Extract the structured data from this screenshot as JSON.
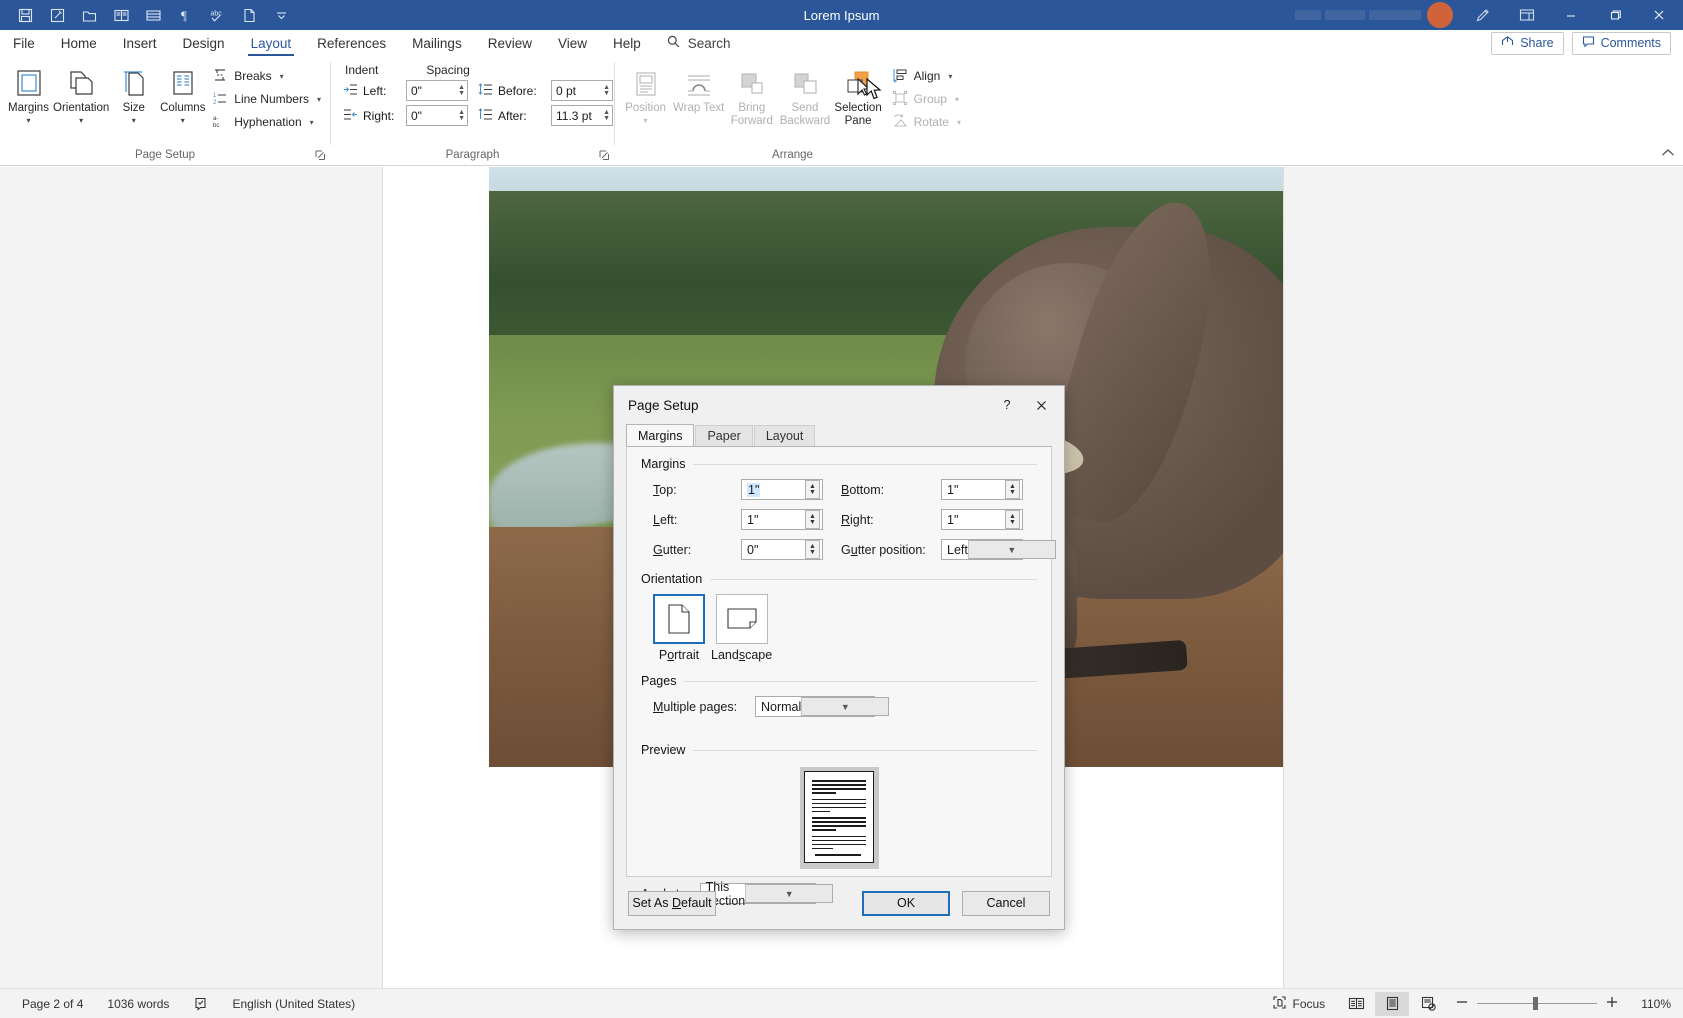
{
  "titlebar": {
    "document_title": "Lorem Ipsum",
    "quick_access": [
      {
        "name": "save-icon",
        "label": "Save"
      },
      {
        "name": "track-changes-icon",
        "label": "Track Changes"
      },
      {
        "name": "open-folder-icon",
        "label": "Open"
      },
      {
        "name": "read-mode-icon",
        "label": "Read Mode"
      },
      {
        "name": "table-icon",
        "label": "Table"
      },
      {
        "name": "paragraph-mark-icon",
        "label": "Show Formatting Marks"
      },
      {
        "name": "spelling-check-icon",
        "label": "Spelling & Grammar"
      },
      {
        "name": "new-document-icon",
        "label": "New"
      },
      {
        "name": "customize-qat-icon",
        "label": "Customize Quick Access Toolbar"
      }
    ],
    "window_controls": [
      "minimize",
      "restore",
      "close"
    ],
    "ribbon_display_icon": "ribbon-display-options-icon",
    "pen_icon": "pen-icon"
  },
  "tabs": {
    "items": [
      "File",
      "Home",
      "Insert",
      "Design",
      "Layout",
      "References",
      "Mailings",
      "Review",
      "View",
      "Help"
    ],
    "active": "Layout",
    "search_placeholder": "Search",
    "share_label": "Share",
    "comments_label": "Comments"
  },
  "ribbon": {
    "groups": [
      {
        "name": "Page Setup",
        "big_buttons": [
          {
            "label": "Margins",
            "icon": "margins-icon",
            "has_chevron": true
          },
          {
            "label": "Orientation",
            "icon": "orientation-icon",
            "has_chevron": true
          },
          {
            "label": "Size",
            "icon": "size-icon",
            "has_chevron": true
          },
          {
            "label": "Columns",
            "icon": "columns-icon",
            "has_chevron": true
          }
        ],
        "small_buttons": [
          {
            "label": "Breaks",
            "icon": "breaks-icon",
            "has_chevron": true
          },
          {
            "label": "Line Numbers",
            "icon": "line-numbers-icon",
            "has_chevron": true
          },
          {
            "label": "Hyphenation",
            "icon": "hyphenation-icon",
            "has_chevron": true
          }
        ]
      },
      {
        "name": "Paragraph",
        "indent_head": "Indent",
        "spacing_head": "Spacing",
        "fields": [
          {
            "label": "Left:",
            "value": "0\"",
            "icon": "indent-left-icon"
          },
          {
            "label": "Right:",
            "value": "0\"",
            "icon": "indent-right-icon"
          },
          {
            "label": "Before:",
            "value": "0 pt",
            "icon": "spacing-before-icon"
          },
          {
            "label": "After:",
            "value": "11.3 pt",
            "icon": "spacing-after-icon"
          }
        ]
      },
      {
        "name": "Arrange",
        "big_buttons": [
          {
            "label": "Position",
            "icon": "position-icon",
            "has_chevron": true,
            "disabled": true
          },
          {
            "label": "Wrap Text",
            "icon": "wrap-text-icon",
            "has_chevron": true,
            "disabled": true
          },
          {
            "label": "Bring Forward",
            "icon": "bring-forward-icon",
            "has_chevron": true,
            "disabled": true
          },
          {
            "label": "Send Backward",
            "icon": "send-backward-icon",
            "has_chevron": true,
            "disabled": true
          },
          {
            "label": "Selection Pane",
            "icon": "selection-pane-icon",
            "has_chevron": false,
            "disabled": false
          }
        ],
        "small_buttons": [
          {
            "label": "Align",
            "icon": "align-icon",
            "has_chevron": true,
            "disabled": false
          },
          {
            "label": "Group",
            "icon": "group-icon",
            "has_chevron": true,
            "disabled": true
          },
          {
            "label": "Rotate",
            "icon": "rotate-icon",
            "has_chevron": true,
            "disabled": true
          }
        ]
      }
    ],
    "collapse_icon": "collapse-ribbon-icon"
  },
  "dialog": {
    "title": "Page Setup",
    "help_icon": "help-question-icon",
    "close_icon": "close-icon",
    "tabs": [
      "Margins",
      "Paper",
      "Layout"
    ],
    "active_tab": "Margins",
    "sections": {
      "margins": {
        "heading": "Margins",
        "fields": [
          {
            "label": "Top:",
            "accel": "T",
            "value": "1\"",
            "selected": true
          },
          {
            "label": "Bottom:",
            "accel": "B",
            "value": "1\"",
            "selected": false
          },
          {
            "label": "Left:",
            "accel": "L",
            "value": "1\"",
            "selected": false
          },
          {
            "label": "Right:",
            "accel": "R",
            "value": "1\"",
            "selected": false
          },
          {
            "label": "Gutter:",
            "accel": "G",
            "value": "0\"",
            "selected": false
          }
        ],
        "gutter_position": {
          "label": "Gutter position:",
          "value": "Left"
        }
      },
      "orientation": {
        "heading": "Orientation",
        "options": [
          {
            "label": "Portrait",
            "icon": "portrait-page-icon",
            "selected": true
          },
          {
            "label": "Landscape",
            "icon": "landscape-page-icon",
            "selected": false
          }
        ]
      },
      "pages": {
        "heading": "Pages",
        "multiple_pages_label": "Multiple pages:",
        "multiple_pages_value": "Normal"
      },
      "preview": {
        "heading": "Preview",
        "apply_to_label": "Apply to:",
        "apply_to_value": "This section"
      }
    },
    "buttons": {
      "set_as_default": "Set As Default",
      "ok": "OK",
      "cancel": "Cancel"
    },
    "accent_color": "#1e6fb8"
  },
  "statusbar": {
    "page": "Page 2 of 4",
    "words": "1036 words",
    "proofing_icon": "proofing-errors-icon",
    "language": "English (United States)",
    "focus_label": "Focus",
    "focus_icon": "focus-mode-icon",
    "views": [
      {
        "name": "read-mode-view-icon",
        "active": false
      },
      {
        "name": "print-layout-view-icon",
        "active": true
      },
      {
        "name": "web-layout-view-icon",
        "active": false
      }
    ],
    "zoom_out_icon": "zoom-out-icon",
    "zoom_in_icon": "zoom-in-icon",
    "zoom_level": "110%"
  },
  "colors": {
    "titlebar": "#2b579a",
    "accent": "#2b579a",
    "dialog_accent": "#1e6fb8",
    "ribbon_bg": "#ffffff",
    "doc_bg": "#f3f3f3"
  }
}
